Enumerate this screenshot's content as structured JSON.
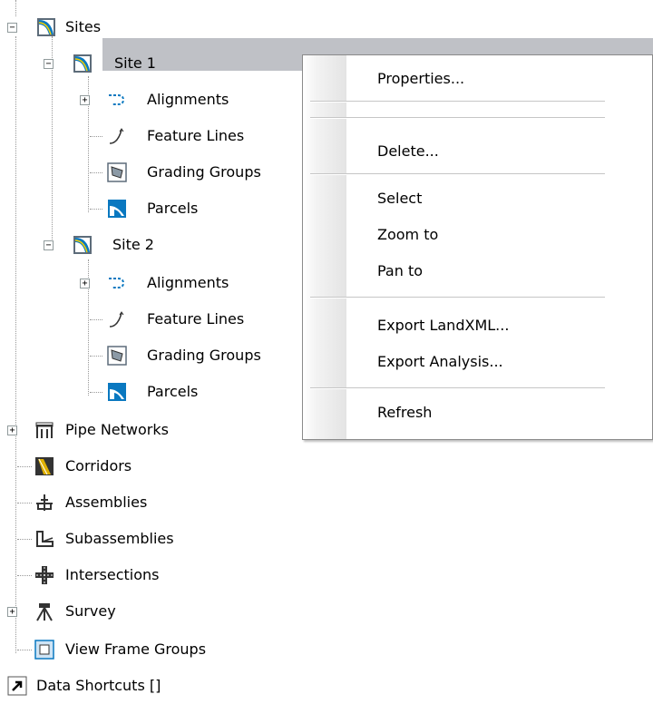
{
  "tree": {
    "sites": "Sites",
    "site1": "Site 1",
    "site1_children": [
      "Alignments",
      "Feature Lines",
      "Grading Groups",
      "Parcels"
    ],
    "site2": "Site 2",
    "site2_children": [
      "Alignments",
      "Feature Lines",
      "Grading Groups",
      "Parcels"
    ],
    "items": [
      "Pipe Networks",
      "Corridors",
      "Assemblies",
      "Subassemblies",
      "Intersections",
      "Survey",
      "View Frame Groups"
    ],
    "data_shortcuts": "Data Shortcuts []"
  },
  "context_menu": {
    "items": [
      "Properties...",
      "Delete...",
      "Select",
      "Zoom to",
      "Pan to",
      "Export LandXML...",
      "Export Analysis...",
      "Refresh"
    ]
  },
  "colors": {
    "selection": "#bfc1c6",
    "accent": "#0a78c0"
  },
  "icons": {
    "site": "site-icon",
    "alignment": "alignment-icon",
    "feature_line": "feature-line-icon",
    "grading_group": "grading-group-icon",
    "parcel": "parcel-icon",
    "pipe": "pipe-network-icon",
    "corridor": "corridor-icon",
    "assembly": "assembly-icon",
    "subassembly": "subassembly-icon",
    "intersection": "intersection-icon",
    "survey": "survey-icon",
    "view_frame": "view-frame-icon",
    "shortcut": "data-shortcut-icon"
  }
}
